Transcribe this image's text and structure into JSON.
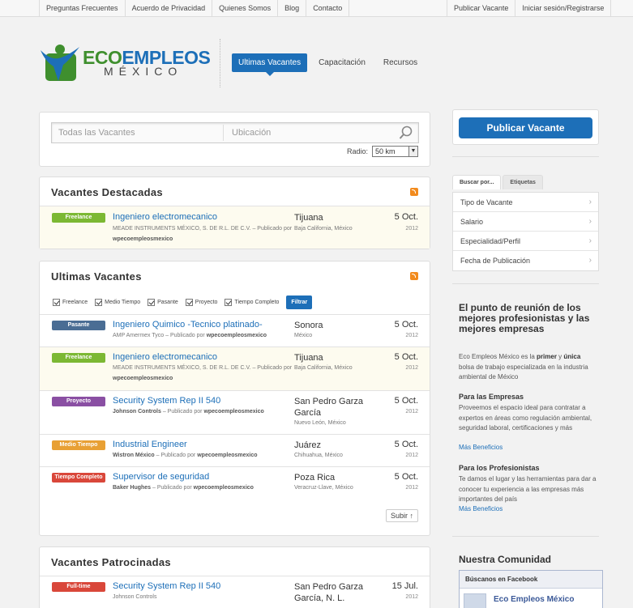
{
  "topbar": {
    "left_links": [
      "Preguntas Frecuentes",
      "Acuerdo de Privacidad",
      "Quienes Somos",
      "Blog",
      "Contacto"
    ],
    "right_links": [
      "Publicar Vacante",
      "Iniciar sesión/Registrarse"
    ]
  },
  "logo": {
    "part1": "ECO",
    "part2": "EMPLEOS",
    "sub": "MÉXICO"
  },
  "nav": {
    "items": [
      "Ultimas Vacantes",
      "Capacitación",
      "Recursos"
    ]
  },
  "search": {
    "keywords_placeholder": "Todas las Vacantes",
    "location_placeholder": "Ubicación",
    "radius_label": "Radio:",
    "radius_value": "50 km"
  },
  "featured": {
    "title": "Vacantes Destacadas",
    "jobs": [
      {
        "badge": "Freelance",
        "title": "Ingeniero electromecanico",
        "company": "MEADE INSTRUMENTS MÉXICO, S. DE R.L. DE C.V.",
        "posted": " – Publicado por ",
        "author": "wpecoempleosmexico",
        "city": "Tijuana",
        "region": "Baja California, México",
        "date": "5 Oct.",
        "year": "2012"
      }
    ]
  },
  "latest": {
    "title": "Ultimas Vacantes",
    "filters": [
      "Freelance",
      "Medio Tiempo",
      "Pasante",
      "Proyecto",
      "Tiempo Completo"
    ],
    "filter_button": "Filtrar",
    "jobs": [
      {
        "badge": "Pasante",
        "title": "Ingeniero Quimico -Tecnico platinado-",
        "company": "AMP Amermex Tyco",
        "posted": " – Publicado por ",
        "author": "wpecoempleosmexico",
        "city": "Sonora",
        "region": "México",
        "date": "5 Oct.",
        "year": "2012"
      },
      {
        "badge": "Freelance",
        "title": "Ingeniero electromecanico",
        "company": "MEADE INSTRUMENTS MÉXICO, S. DE R.L. DE C.V.",
        "posted": " – Publicado por ",
        "author": "wpecoempleosmexico",
        "city": "Tijuana",
        "region": "Baja California, México",
        "date": "5 Oct.",
        "year": "2012"
      },
      {
        "badge": "Proyecto",
        "title": "Security System Rep II 540",
        "company": "Johnson Controls",
        "posted": " – Publicado por ",
        "author": "wpecoempleosmexico",
        "city": "San Pedro Garza García",
        "region": "Nuevo León, México",
        "date": "5 Oct.",
        "year": "2012"
      },
      {
        "badge": "Medio Tiempo",
        "title": "Industrial Engineer",
        "company": "Wistron México",
        "posted": " – Publicado por ",
        "author": "wpecoempleosmexico",
        "city": "Juárez",
        "region": "Chihuahua, México",
        "date": "5 Oct.",
        "year": "2012"
      },
      {
        "badge": "Tiempo Completo",
        "title": "Supervisor de seguridad",
        "company": "Baker Hughes",
        "posted": " – Publicado por ",
        "author": "wpecoempleosmexico",
        "city": "Poza Rica",
        "region": "Veracruz-Llave, México",
        "date": "5 Oct.",
        "year": "2012"
      }
    ],
    "up_button": "Subir ↑"
  },
  "sponsored": {
    "title": "Vacantes Patrocinadas",
    "jobs": [
      {
        "badge": "Full-time",
        "title": "Security System Rep II 540",
        "company": "Johnson Controls",
        "city": "San Pedro Garza García, N. L.",
        "date": "15 Jul.",
        "year": "2012"
      }
    ]
  },
  "sidebar": {
    "post_button": "Publicar Vacante",
    "tabs": [
      "Buscar por...",
      "Etiquetas"
    ],
    "filter_items": [
      "Tipo de Vacante",
      "Salario",
      "Especialidad/Perfil",
      "Fecha de Publicación"
    ],
    "about_title": "El punto de reunión de los mejores profesionistas y las mejores empresas",
    "about_p1": "Eco Empleos México es la ",
    "about_b1": "primer",
    "about_p2": " y ",
    "about_b2": "única",
    "about_p3": " bolsa de trabajo especializada en la industria ambiental de México",
    "companies_title": "Para las Empresas",
    "companies_text": "Proveemos el espacio ideal para contratar a expertos en áreas como regulación ambiental, seguridad laboral, certificaciones y más",
    "companies_more": "Más Beneficios",
    "pros_title": "Para los Profesionistas",
    "pros_text": "Te damos el lugar y las herramientas para dar a conocer tu experiencia a las empresas más importantes del país",
    "pros_more": "Más Beneficios",
    "community_title": "Nuestra Comunidad",
    "facebook_header": "Búscanos en Facebook",
    "facebook_page": "Eco Empleos México"
  },
  "colors": {
    "brand_blue": "#1d6fb8",
    "brand_green": "#3f8f2e",
    "freelance": "#7cb833",
    "pasante": "#4a6d94",
    "proyecto": "#8a4fa3",
    "medio_tiempo": "#e8a034",
    "tiempo_completo": "#d9473a"
  }
}
